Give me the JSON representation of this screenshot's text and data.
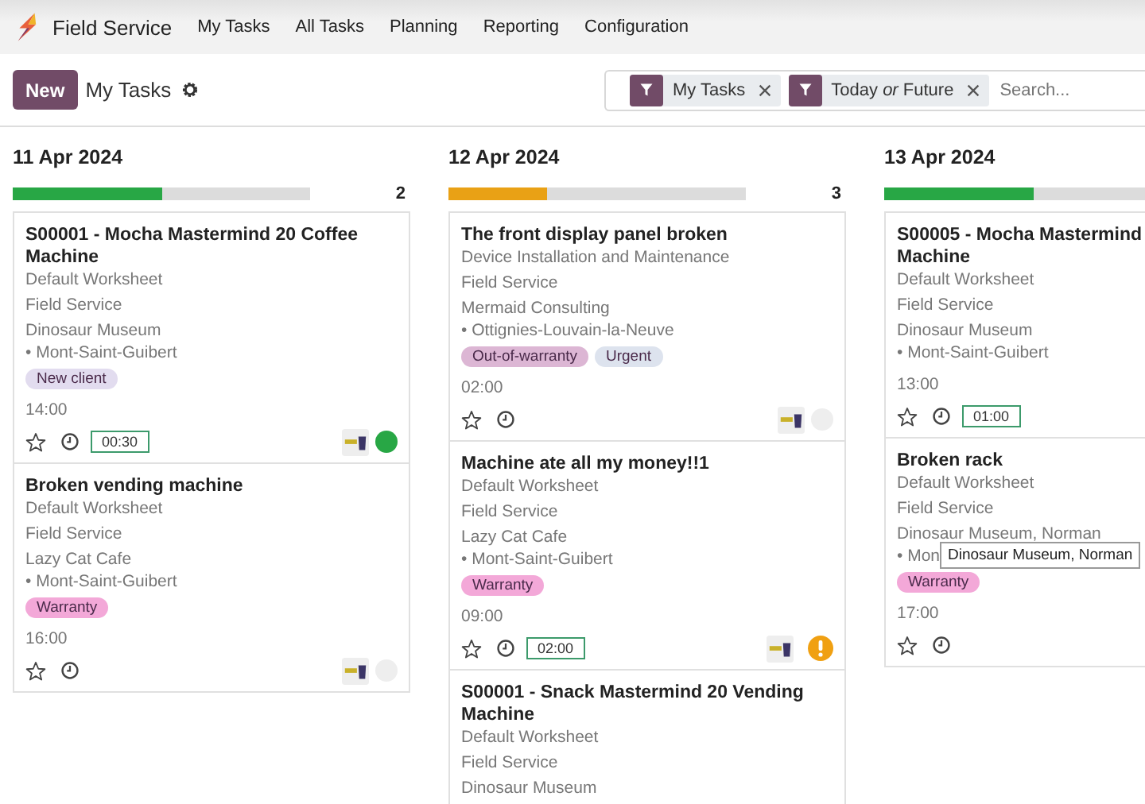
{
  "app": {
    "name": "Field Service",
    "menu": [
      "My Tasks",
      "All Tasks",
      "Planning",
      "Reporting",
      "Configuration"
    ]
  },
  "control": {
    "new_button": "New",
    "breadcrumb": "My Tasks",
    "facets": [
      "My Tasks",
      "Today *or* Future"
    ],
    "search": {
      "placeholder": "Search..."
    }
  },
  "columns": [
    {
      "date": "11 Apr 2024",
      "level": 0.5,
      "color": "#28a745",
      "count": "2",
      "cards": [
        {
          "title": "S00001 - Mocha Mastermind 20 Coffee Machine",
          "worksheet": "Default Worksheet",
          "project": "Field Service",
          "customer": "Dinosaur Museum",
          "city": "• Mont-Saint-Guibert",
          "tags": [
            {
              "label": "New client",
              "color": "#e2dcef"
            }
          ],
          "time": "14:00",
          "starred": false,
          "duration": "00:30",
          "avatar": true,
          "status": {
            "kind": "dot",
            "color": "#28a745"
          }
        },
        {
          "title": "Broken vending machine",
          "worksheet": "Default Worksheet",
          "project": "Field Service",
          "customer": "Lazy Cat Cafe",
          "city": "• Mont-Saint-Guibert",
          "tags": [
            {
              "label": "Warranty",
              "color": "#f3a8d8"
            }
          ],
          "time": "16:00",
          "starred": false,
          "avatar": true,
          "status": {
            "kind": "dot",
            "color": "#eeeeee"
          }
        }
      ]
    },
    {
      "date": "12 Apr 2024",
      "level": 0.33,
      "color": "#e9a115",
      "count": "3",
      "cards": [
        {
          "title": "The front display panel broken",
          "worksheet": "Device Installation and Maintenance",
          "project": "Field Service",
          "customer": "Mermaid Consulting",
          "city": "• Ottignies-Louvain-la-Neuve",
          "tags": [
            {
              "label": "Out-of-warranty",
              "color": "#dcb6d4"
            },
            {
              "label": "Urgent",
              "color": "#dde3ee"
            }
          ],
          "time": "02:00",
          "starred": false,
          "avatar": true,
          "status": {
            "kind": "dot",
            "color": "#eeeeee"
          }
        },
        {
          "title": "Machine ate all my money!!1",
          "worksheet": "Default Worksheet",
          "project": "Field Service",
          "customer": "Lazy Cat Cafe",
          "city": "• Mont-Saint-Guibert",
          "tags": [
            {
              "label": "Warranty",
              "color": "#f3a8d8"
            }
          ],
          "time": "09:00",
          "starred": false,
          "duration": "02:00",
          "avatar": true,
          "status": {
            "kind": "warning",
            "color": "#f0a012"
          }
        },
        {
          "title": "S00001 - Snack Mastermind 20 Vending Machine",
          "worksheet": "Default Worksheet",
          "project": "Field Service",
          "customer": "Dinosaur Museum"
        }
      ]
    },
    {
      "date": "13 Apr 2024",
      "level": 0.5,
      "color": "#28a745",
      "cards": [
        {
          "title": "S00005 - Mocha Mastermind\nMachine",
          "worksheet": "Default Worksheet",
          "project": "Field Service",
          "customer": "Dinosaur Museum",
          "city": "• Mont-Saint-Guibert",
          "time": "13:00",
          "starred": false,
          "duration": "01:00"
        },
        {
          "title": "Broken rack",
          "worksheet": "Default Worksheet",
          "project": "Field Service",
          "customer": "Dinosaur Museum, Norman",
          "city": "• Mon",
          "tooltip": "Dinosaur Museum, Norman",
          "tags": [
            {
              "label": "Warranty",
              "color": "#f3a8d8"
            }
          ],
          "time": "17:00",
          "starred": false
        }
      ]
    }
  ]
}
